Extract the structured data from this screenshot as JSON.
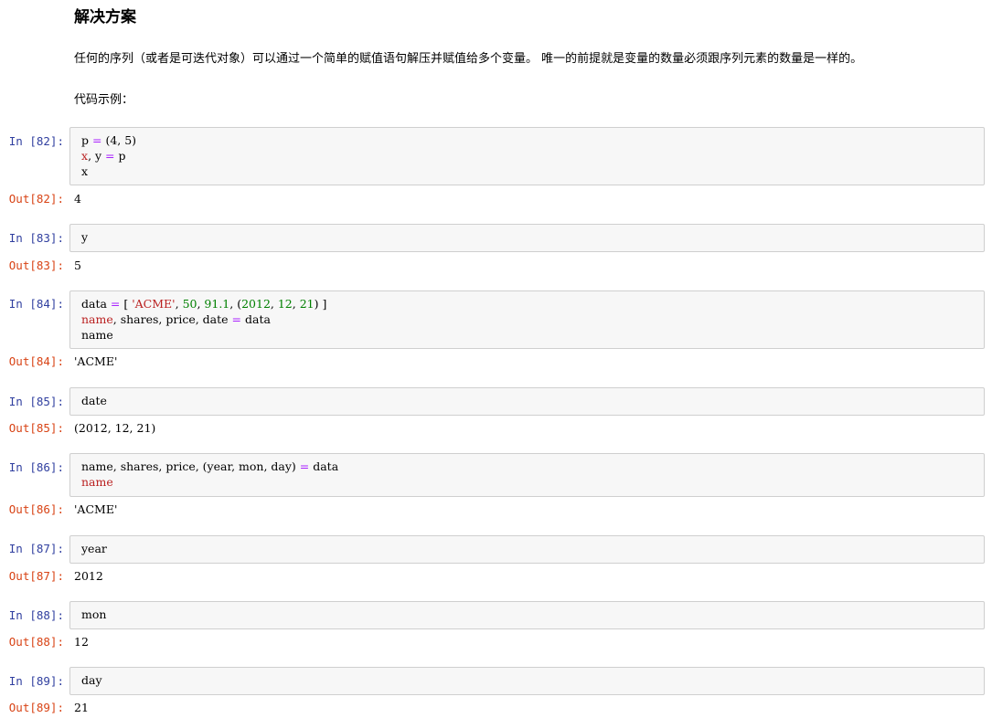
{
  "markdown": {
    "title": "解决方案",
    "paragraph": "任何的序列（或者是可迭代对象）可以通过一个简单的赋值语句解压并赋值给多个变量。 唯一的前提就是变量的数量必须跟序列元素的数量是一样的。",
    "example_label": "代码示例："
  },
  "cells": [
    {
      "in_prompt": "In  [82]:",
      "out_prompt": "Out[82]:",
      "output": "4",
      "lines": [
        [
          {
            "t": "p "
          },
          {
            "t": "=",
            "c": "op"
          },
          {
            "t": " (4, 5)"
          }
        ],
        [
          {
            "t": "x",
            "c": "var"
          },
          {
            "t": ", y "
          },
          {
            "t": "=",
            "c": "op"
          },
          {
            "t": " p"
          }
        ],
        [
          {
            "t": "x"
          }
        ]
      ]
    },
    {
      "in_prompt": "In  [83]:",
      "out_prompt": "Out[83]:",
      "output": "5",
      "lines": [
        [
          {
            "t": "y"
          }
        ]
      ]
    },
    {
      "in_prompt": "In  [84]:",
      "out_prompt": "Out[84]:",
      "output": "'ACME'",
      "lines": [
        [
          {
            "t": "data "
          },
          {
            "t": "=",
            "c": "op"
          },
          {
            "t": " [ "
          },
          {
            "t": "'ACME'",
            "c": "str"
          },
          {
            "t": ", "
          },
          {
            "t": "50",
            "c": "num"
          },
          {
            "t": ", "
          },
          {
            "t": "91.1",
            "c": "num"
          },
          {
            "t": ", ("
          },
          {
            "t": "2012",
            "c": "num"
          },
          {
            "t": ", "
          },
          {
            "t": "12",
            "c": "num"
          },
          {
            "t": ", "
          },
          {
            "t": "21",
            "c": "num"
          },
          {
            "t": ") ]"
          }
        ],
        [
          {
            "t": "name",
            "c": "var"
          },
          {
            "t": ", shares, price, date "
          },
          {
            "t": "=",
            "c": "op"
          },
          {
            "t": " data"
          }
        ],
        [
          {
            "t": "name"
          }
        ]
      ]
    },
    {
      "in_prompt": "In  [85]:",
      "out_prompt": "Out[85]:",
      "output": "(2012, 12, 21)",
      "lines": [
        [
          {
            "t": "date"
          }
        ]
      ]
    },
    {
      "in_prompt": "In  [86]:",
      "out_prompt": "Out[86]:",
      "output": "'ACME'",
      "lines": [
        [
          {
            "t": "name, shares, price, (year, mon, day) "
          },
          {
            "t": "=",
            "c": "op"
          },
          {
            "t": " data"
          }
        ],
        [
          {
            "t": "name",
            "c": "var"
          }
        ]
      ]
    },
    {
      "in_prompt": "In  [87]:",
      "out_prompt": "Out[87]:",
      "output": "2012",
      "lines": [
        [
          {
            "t": "year"
          }
        ]
      ]
    },
    {
      "in_prompt": "In  [88]:",
      "out_prompt": "Out[88]:",
      "output": "12",
      "lines": [
        [
          {
            "t": "mon"
          }
        ]
      ]
    },
    {
      "in_prompt": "In  [89]:",
      "out_prompt": "Out[89]:",
      "output": "21",
      "lines": [
        [
          {
            "t": "day"
          }
        ]
      ]
    }
  ]
}
